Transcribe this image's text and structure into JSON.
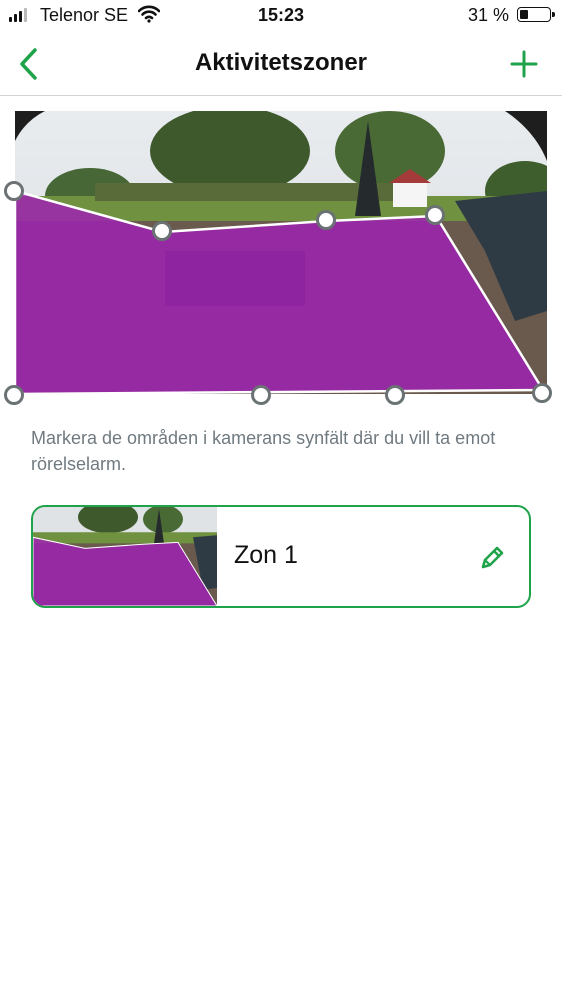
{
  "status_bar": {
    "carrier": "Telenor SE",
    "time": "15:23",
    "battery_percent_label": "31 %",
    "battery_level": 0.31
  },
  "nav": {
    "title": "Aktivitetszoner",
    "back_icon": "chevron-left-icon",
    "add_icon": "plus-icon"
  },
  "zone_editor": {
    "description": "Markera de områden i kamerans synfält där du vill ta emot rörelselarm.",
    "zone_color": "#a020b4"
  },
  "zones": [
    {
      "name": "Zon 1",
      "edit_icon": "pencil-icon"
    }
  ],
  "colors": {
    "accent": "#1fa34a",
    "zone_overlay": "#a020b4",
    "handle_border": "#6b7274"
  }
}
